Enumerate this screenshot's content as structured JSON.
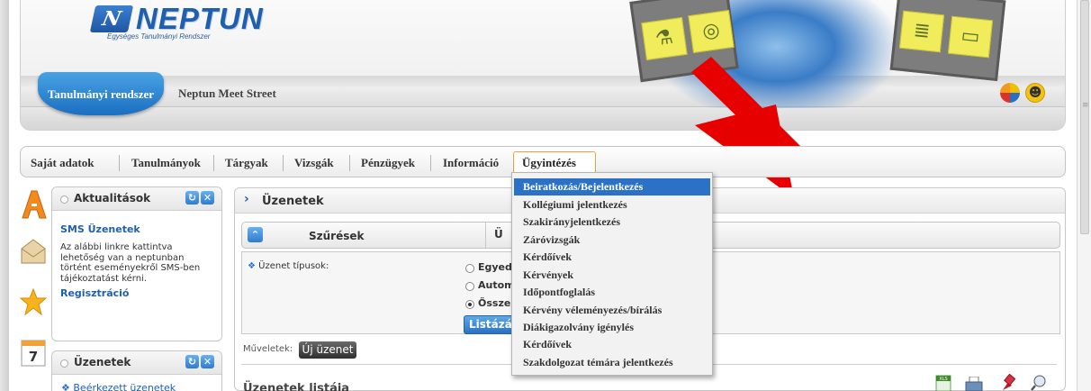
{
  "header": {
    "logo_text": "NEPTUN",
    "logo_badge": "N",
    "logo_subtitle": "Egységes Tanulmányi Rendszer",
    "tabs": [
      {
        "label": "Tanulmányi rendszer",
        "active": true
      },
      {
        "label": "Neptun Meet Street",
        "active": false
      }
    ]
  },
  "mainnav": {
    "items": [
      {
        "label": "Saját adatok"
      },
      {
        "label": "Tanulmányok"
      },
      {
        "label": "Tárgyak"
      },
      {
        "label": "Vizsgák"
      },
      {
        "label": "Pénzügyek"
      },
      {
        "label": "Információ"
      },
      {
        "label": "Ügyintézés",
        "active": true
      }
    ]
  },
  "dropdown": {
    "items": [
      {
        "label": "Beiratkozás/Bejelentkezés",
        "selected": true
      },
      {
        "label": "Kollégiumi jelentkezés"
      },
      {
        "label": "Szakirányjelentkezés"
      },
      {
        "label": "Záróvizsgák"
      },
      {
        "label": "Kérdőívek"
      },
      {
        "label": "Kérvények"
      },
      {
        "label": "Időpontfoglalás"
      },
      {
        "label": "Kérvény véleményezés/bírálás"
      },
      {
        "label": "Diákigazolvány igénylés"
      },
      {
        "label": "Kérdőívek"
      },
      {
        "label": "Szakdolgozat témára jelentkezés"
      }
    ]
  },
  "widgets": {
    "news": {
      "title": "Aktualitások",
      "item_title": "SMS Üzenetek",
      "item_text_lines": [
        "Az alábbi linkre kattintva",
        "lehetőség van a neptunban",
        "történt eseményekről SMS-ben",
        "tájékoztatást kérni."
      ],
      "link": "Regisztráció"
    },
    "messages": {
      "title": "Üzenetek",
      "link": "Beérkezett üzenetek"
    }
  },
  "content": {
    "title": "Üzenetek",
    "filter_title": "Szűrések",
    "filter_tab_partial": "Ü",
    "message_type_label": "Üzenet típusok:",
    "radio_options": [
      {
        "label": "Egyed",
        "checked": false
      },
      {
        "label": "Autom",
        "checked": false
      },
      {
        "label": "Össze",
        "checked": true
      }
    ],
    "list_button": "Listázás",
    "operations_label": "Műveletek:",
    "new_message_button": "Új üzenet",
    "list_title": "Üzenetek listája",
    "toolbar_icons": [
      "xls-export-icon",
      "print-icon",
      "pin-icon",
      "search-icon"
    ]
  },
  "colors": {
    "brand_blue": "#1f5fae",
    "active_tab": "#e4a33c",
    "menu_highlight": "#2b72c7",
    "arrow_red": "#e60000"
  },
  "side_icons": [
    "letter-a-icon",
    "envelope-icon",
    "star-icon",
    "calendar-icon"
  ],
  "calendar_day": "7"
}
